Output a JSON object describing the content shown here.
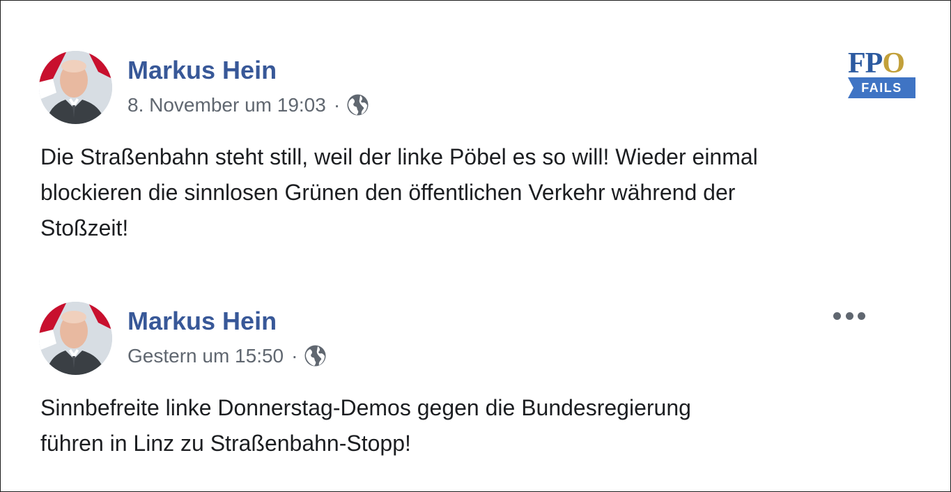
{
  "logo": {
    "letters_fp": "FP",
    "letter_o": "O",
    "banner": "FAILS"
  },
  "posts": [
    {
      "author": "Markus Hein",
      "timestamp": "8. November um 19:03",
      "separator": "·",
      "privacy_icon": "globe-icon",
      "text_lines": [
        "Die Straßenbahn steht still, weil der linke Pöbel es so will! Wieder einmal",
        "blockieren die sinnlosen Grünen den öffentlichen Verkehr während der",
        "Stoßzeit!"
      ]
    },
    {
      "author": "Markus Hein",
      "timestamp": "Gestern um 15:50",
      "separator": "·",
      "privacy_icon": "globe-icon",
      "more_icon": "more-options-icon",
      "text_lines": [
        "Sinnbefreite linke Donnerstag-Demos gegen die Bundesregierung",
        "führen in Linz zu Straßenbahn-Stopp!"
      ]
    }
  ],
  "colors": {
    "author_link": "#385898",
    "meta_text": "#606770",
    "body_text": "#1c1e21",
    "logo_blue": "#2c5aa0",
    "logo_gold": "#c2a03a"
  }
}
